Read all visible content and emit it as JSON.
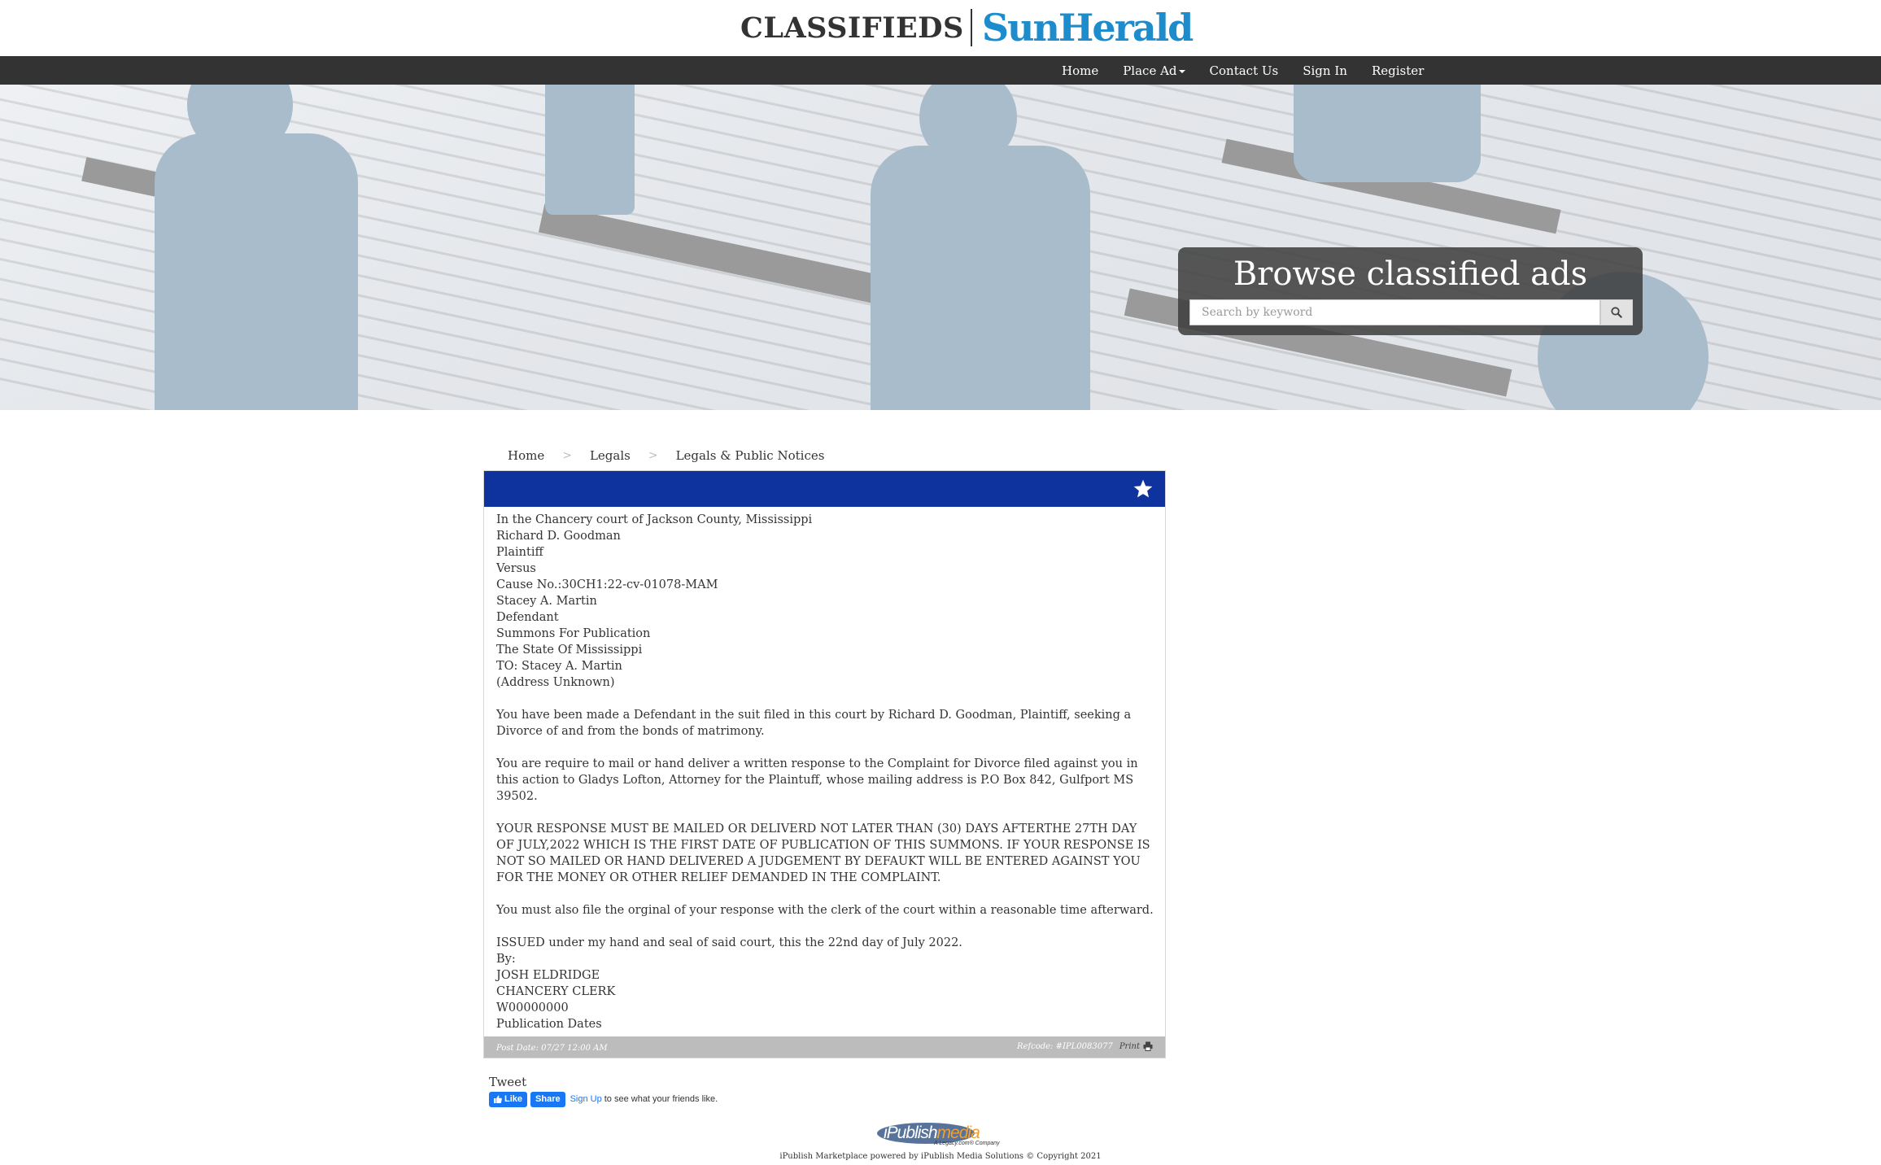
{
  "brand": {
    "classifieds": "CLASSIFIEDS",
    "paper": "SunHerald"
  },
  "nav": {
    "home": "Home",
    "place_ad": "Place Ad",
    "contact": "Contact Us",
    "sign_in": "Sign In",
    "register": "Register"
  },
  "hero": {
    "title": "Browse classified ads",
    "search_placeholder": "Search by keyword",
    "search_icon": "search-icon"
  },
  "breadcrumb": {
    "items": [
      "Home",
      "Legals",
      "Legals & Public Notices"
    ],
    "separator": ">"
  },
  "ad": {
    "header_icon": "star-icon",
    "header_color": "#0e339e",
    "lines": [
      "In the Chancery court of Jackson County, Mississippi",
      "Richard D. Goodman",
      "Plaintiff",
      "Versus",
      "Cause No.:30CH1:22-cv-01078-MAM",
      "Stacey A. Martin",
      "Defendant",
      "Summons For Publication",
      "The State Of Mississippi",
      "TO: Stacey A. Martin",
      "(Address Unknown)"
    ],
    "paragraphs": [
      "You have been made a Defendant in the suit filed in this court by Richard D. Goodman, Plaintiff, seeking a Divorce of and from the bonds of matrimony.",
      "You are require to mail or hand deliver a written response to the Complaint for Divorce filed against you in this action to Gladys Lofton, Attorney for the Plaintuff, whose mailing address is P.O Box 842, Gulfport MS 39502.",
      "YOUR RESPONSE MUST BE MAILED OR DELIVERD NOT LATER THAN (30) DAYS AFTERTHE 27TH DAY OF JULY,2022 WHICH IS THE FIRST DATE OF PUBLICATION OF THIS SUMMONS. IF YOUR RESPONSE IS NOT SO MAILED OR HAND DELIVERED A JUDGEMENT BY DEFAUKT WILL BE ENTERED AGAINST YOU FOR THE MONEY OR OTHER RELIEF DEMANDED IN THE COMPLAINT.",
      "You must also file the orginal of your response with the clerk of the court within a reasonable time afterward."
    ],
    "closing": [
      "ISSUED under my hand and seal of said court, this the 22nd day of July 2022.",
      "By:",
      "JOSH ELDRIDGE",
      "CHANCERY CLERK",
      "W00000000",
      "Publication Dates"
    ],
    "post_date": "Post Date: 07/27 12:00 AM",
    "refcode": "Refcode: #IPL0083077",
    "print_label": "Print",
    "print_icon": "printer-icon"
  },
  "social": {
    "tweet": "Tweet",
    "like": "Like",
    "share": "Share",
    "sign_up": "Sign Up",
    "sign_up_text": "to see what your friends like."
  },
  "footer": {
    "logo_ipublish": "iPublish",
    "logo_media": "media",
    "logo_tagline": "A Legacy.com® Company",
    "copyright": "iPublish Marketplace powered by iPublish Media Solutions © Copyright 2021"
  }
}
